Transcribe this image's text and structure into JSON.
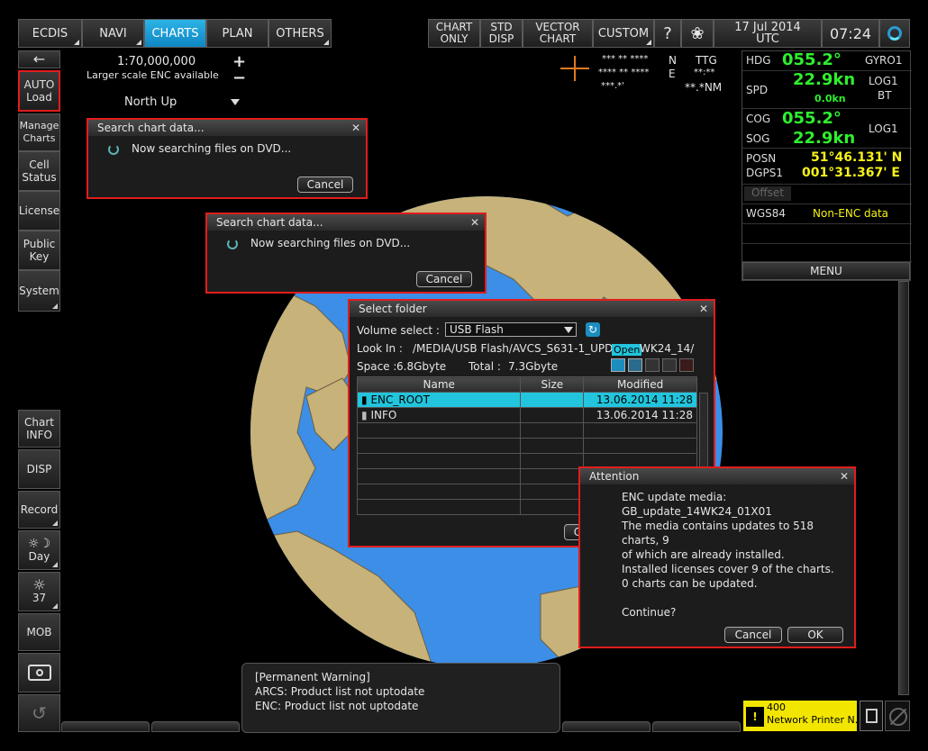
{
  "topbar": {
    "tabs": [
      "ECDIS",
      "NAVI",
      "CHARTS",
      "PLAN",
      "OTHERS"
    ],
    "right_tabs": [
      [
        "CHART",
        "ONLY"
      ],
      [
        "STD",
        "DISP"
      ],
      [
        "VECTOR",
        "CHART"
      ]
    ],
    "custom": "CUSTOM",
    "date": "17 Jul 2014",
    "tz": "UTC",
    "time": "07:24"
  },
  "chart": {
    "scale": "1:70,000,000",
    "larger_scale": "Larger scale ENC available",
    "orientation": "North Up",
    "plus": "+",
    "minus": "−"
  },
  "cursor_readout": {
    "lat": "*** ** ****",
    "lat_ns": "N",
    "lon": "**** ** ****",
    "lon_ew": "E",
    "ttg_label": "TTG",
    "ttg": "**:**",
    "dist": "***.*'",
    "dist2": "**.*NM"
  },
  "sidebar": {
    "arrow": "←",
    "auto_load": [
      "AUTO",
      "Load"
    ],
    "manage_charts": [
      "Manage",
      "Charts"
    ],
    "cell_status": [
      "Cell",
      "Status"
    ],
    "license": "License",
    "public_key": [
      "Public",
      "Key"
    ],
    "system": "System",
    "chart_info": [
      "Chart",
      "INFO"
    ],
    "disp": "DISP",
    "record": "Record",
    "day": "Day",
    "bright": "37",
    "mob": "MOB"
  },
  "nav": {
    "hdg_label": "HDG",
    "hdg": "055.2°",
    "hdg_src": "GYRO1",
    "spd_label": "SPD",
    "spd": "22.9kn",
    "spd2": "0.0kn",
    "spd_src": [
      "LOG1",
      "BT"
    ],
    "cog_label": "COG",
    "cog": "055.2°",
    "sog_label": "SOG",
    "sog": "22.9kn",
    "cogsog_src": "LOG1",
    "posn_label": "POSN",
    "dgps_label": "DGPS1",
    "lat": "51°46.131' N",
    "lon": "001°31.367' E",
    "offset": "Offset",
    "datum": "WGS84",
    "enc": "Non-ENC data",
    "menu": "MENU"
  },
  "search1": {
    "title": "Search chart data...",
    "msg": "Now searching files on DVD...",
    "cancel": "Cancel"
  },
  "search2": {
    "title": "Search chart data...",
    "msg": "Now searching files on DVD...",
    "cancel": "Cancel"
  },
  "folder": {
    "title": "Select folder",
    "volume_label": "Volume select :",
    "volume": "USB Flash",
    "lookin_label": "Look In :",
    "lookin": "/MEDIA/USB Flash/AVCS_S631-1_UPDATE",
    "lookin_end": "WK24_14/",
    "open_tip": "Open",
    "space_label": "Space :",
    "space": "6.8Gbyte",
    "total_label": "Total :",
    "total": "7.3Gbyte",
    "col_name": "Name",
    "col_size": "Size",
    "col_modified": "Modified",
    "rows": [
      {
        "name": "ENC_ROOT",
        "size": "",
        "modified": "13.06.2014 11:28"
      },
      {
        "name": "INFO",
        "size": "",
        "modified": "13.06.2014 11:28"
      }
    ],
    "button_partial": "C"
  },
  "attention": {
    "title": "Attention",
    "lines": [
      "ENC update media:",
      "GB_update_14WK24_01X01",
      "The media contains updates to 518 charts, 9",
      "of which are already installed.",
      "Installed licenses cover 9 of the charts.",
      "0 charts can be updated.",
      "",
      "Continue?"
    ],
    "cancel": "Cancel",
    "ok": "OK"
  },
  "warning": {
    "lines": [
      "[Permanent Warning]",
      "ARCS: Product list not uptodate",
      "ENC: Product list not uptodate"
    ]
  },
  "alert": {
    "code": "400",
    "text": "Network Printer N..",
    "icon": "!"
  }
}
